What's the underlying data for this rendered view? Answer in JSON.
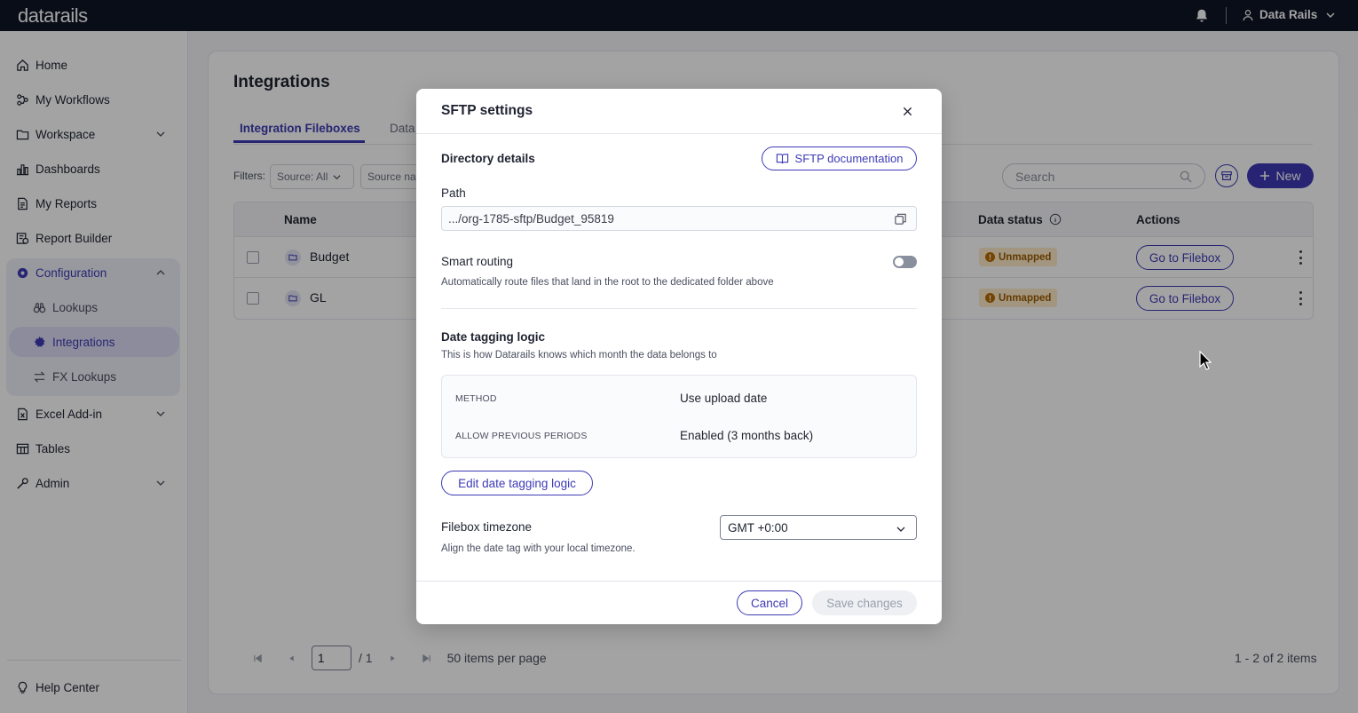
{
  "topbar": {
    "logo": "datarails",
    "user_name": "Data Rails"
  },
  "sidebar": {
    "items": [
      {
        "label": "Home",
        "icon": "home-icon"
      },
      {
        "label": "My Workflows",
        "icon": "workflow-icon"
      },
      {
        "label": "Workspace",
        "icon": "folder-icon"
      },
      {
        "label": "Dashboards",
        "icon": "bar-chart-icon"
      },
      {
        "label": "My Reports",
        "icon": "document-icon"
      },
      {
        "label": "Report Builder",
        "icon": "report-builder-icon"
      },
      {
        "label": "Configuration",
        "icon": "gear-icon"
      },
      {
        "label": "Lookups",
        "icon": "binoculars-icon"
      },
      {
        "label": "Integrations",
        "icon": "gear-icon"
      },
      {
        "label": "FX Lookups",
        "icon": "exchange-icon"
      },
      {
        "label": "Excel Add-in",
        "icon": "excel-icon"
      },
      {
        "label": "Tables",
        "icon": "table-icon"
      },
      {
        "label": "Admin",
        "icon": "wrench-icon"
      }
    ],
    "help": "Help Center"
  },
  "page": {
    "title": "Integrations",
    "tabs": [
      "Integration Fileboxes",
      "Data"
    ],
    "filters_label": "Filters:",
    "filter_source": "Source: All",
    "filter_source_name": "Source na",
    "search_placeholder": "Search",
    "new_label": "New"
  },
  "table": {
    "headers": {
      "name": "Name",
      "data_status": "Data status",
      "actions": "Actions"
    },
    "rows": [
      {
        "name": "Budget",
        "status": "Unmapped",
        "action": "Go to Filebox"
      },
      {
        "name": "GL",
        "status": "Unmapped",
        "action": "Go to Filebox"
      }
    ]
  },
  "pagination": {
    "page": "1",
    "total_pages": "/ 1",
    "per_page": "50 items per page",
    "summary": "1 - 2 of 2 items"
  },
  "modal": {
    "title": "SFTP settings",
    "directory_details": "Directory details",
    "doc_button": "SFTP documentation",
    "path_label": "Path",
    "path_value": ".../org-1785-sftp/Budget_95819",
    "smart_routing_label": "Smart routing",
    "smart_routing_on": false,
    "smart_routing_help": "Automatically route files that land in the root to the dedicated folder above",
    "date_logic_title": "Date tagging logic",
    "date_logic_help": "This is how Datarails knows which month the data belongs to",
    "method_key": "METHOD",
    "method_value": "Use upload date",
    "prev_key": "ALLOW PREVIOUS PERIODS",
    "prev_value": "Enabled (3 months back)",
    "edit_button": "Edit date tagging logic",
    "timezone_label": "Filebox timezone",
    "timezone_help": "Align the date tag with your local timezone.",
    "timezone_value": "GMT +0:00",
    "cancel": "Cancel",
    "save": "Save changes"
  },
  "colors": {
    "accent": "#3d3ab5",
    "topbar": "#0f1527",
    "badge_bg": "#fdebc8",
    "badge_text": "#9b5c00"
  }
}
